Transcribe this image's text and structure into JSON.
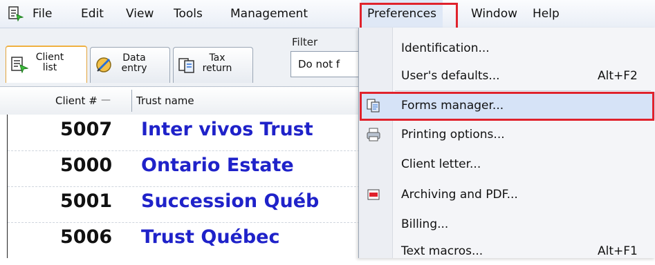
{
  "menubar": {
    "items": [
      "File",
      "Edit",
      "View",
      "Tools",
      "Management",
      "Preferences",
      "Window",
      "Help"
    ]
  },
  "tabs": [
    {
      "label": "Client list",
      "icon": "client-list-icon"
    },
    {
      "label": "Data entry",
      "icon": "data-entry-icon"
    },
    {
      "label": "Tax return",
      "icon": "tax-return-icon"
    }
  ],
  "filter": {
    "label": "Filter",
    "value": "Do not f"
  },
  "grid": {
    "columns": [
      "Client #",
      "Trust name"
    ],
    "rows": [
      {
        "number": "5007",
        "name": "Inter vivos Trust"
      },
      {
        "number": "5000",
        "name": "Ontario Estate"
      },
      {
        "number": "5001",
        "name": "Succession Québ"
      },
      {
        "number": "5006",
        "name": "Trust Québec"
      }
    ]
  },
  "preferences_menu": {
    "items": [
      {
        "label": "Identification...",
        "shortcut": ""
      },
      {
        "label": "User's defaults...",
        "shortcut": "Alt+F2"
      },
      {
        "label": "Forms manager...",
        "shortcut": "",
        "icon": "forms-manager-icon"
      },
      {
        "label": "Printing options...",
        "shortcut": "",
        "icon": "printer-icon"
      },
      {
        "label": "Client letter...",
        "shortcut": ""
      },
      {
        "label": "Archiving and PDF...",
        "shortcut": "",
        "icon": "pdf-icon"
      },
      {
        "label": "Billing...",
        "shortcut": ""
      },
      {
        "label": "Text macros...",
        "shortcut": "Alt+F1"
      }
    ]
  },
  "colors": {
    "highlight": "#e0222c",
    "trust_name": "#1f22c9",
    "hover": "#d6e3f7"
  }
}
